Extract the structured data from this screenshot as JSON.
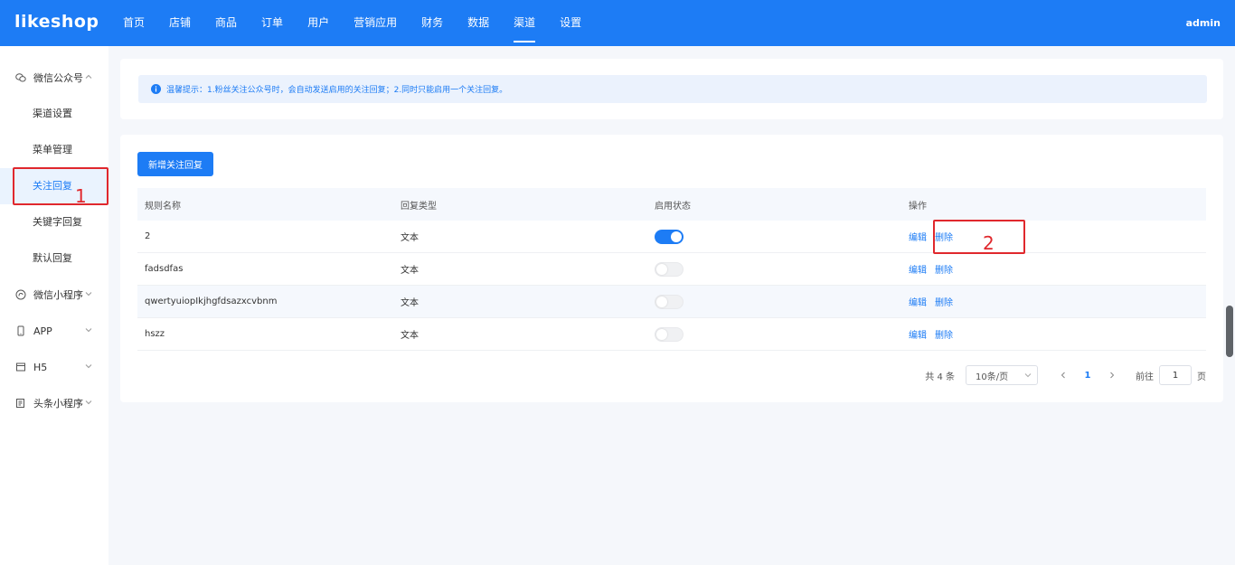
{
  "header": {
    "logo": "likeshop",
    "nav": [
      "首页",
      "店铺",
      "商品",
      "订单",
      "用户",
      "营销应用",
      "财务",
      "数据",
      "渠道",
      "设置"
    ],
    "active_nav": "渠道",
    "user": "admin"
  },
  "sidebar": {
    "groups": [
      {
        "label": "微信公众号",
        "icon": "wechat-icon",
        "expanded": true,
        "items": [
          "渠道设置",
          "菜单管理",
          "关注回复",
          "关键字回复",
          "默认回复"
        ]
      },
      {
        "label": "微信小程序",
        "icon": "miniprogram-icon"
      },
      {
        "label": "APP",
        "icon": "phone-icon"
      },
      {
        "label": "H5",
        "icon": "h5-icon"
      },
      {
        "label": "头条小程序",
        "icon": "toutiao-icon"
      }
    ],
    "active_item": "关注回复"
  },
  "tip": {
    "text": "温馨提示：1.粉丝关注公众号时，会自动发送启用的关注回复；2.同时只能启用一个关注回复。"
  },
  "toolbar": {
    "add_label": "新增关注回复"
  },
  "table": {
    "headers": [
      "规则名称",
      "回复类型",
      "启用状态",
      "操作"
    ],
    "rows": [
      {
        "name": "2",
        "type": "文本",
        "enabled": true
      },
      {
        "name": "fadsdfas",
        "type": "文本",
        "enabled": false
      },
      {
        "name": "qwertyuiopIkjhgfdsazxcvbnm",
        "type": "文本",
        "enabled": false
      },
      {
        "name": "hszz",
        "type": "文本",
        "enabled": false
      }
    ],
    "edit_label": "编辑",
    "delete_label": "删除"
  },
  "pagination": {
    "total": "共 4 条",
    "page_size": "10条/页",
    "current_page": "1",
    "goto_label": "前往",
    "goto_value": "1",
    "page_suffix": "页"
  },
  "annotations": [
    "1",
    "2"
  ],
  "colors": {
    "primary": "#1d7cf5",
    "annotation": "#e0282d"
  }
}
